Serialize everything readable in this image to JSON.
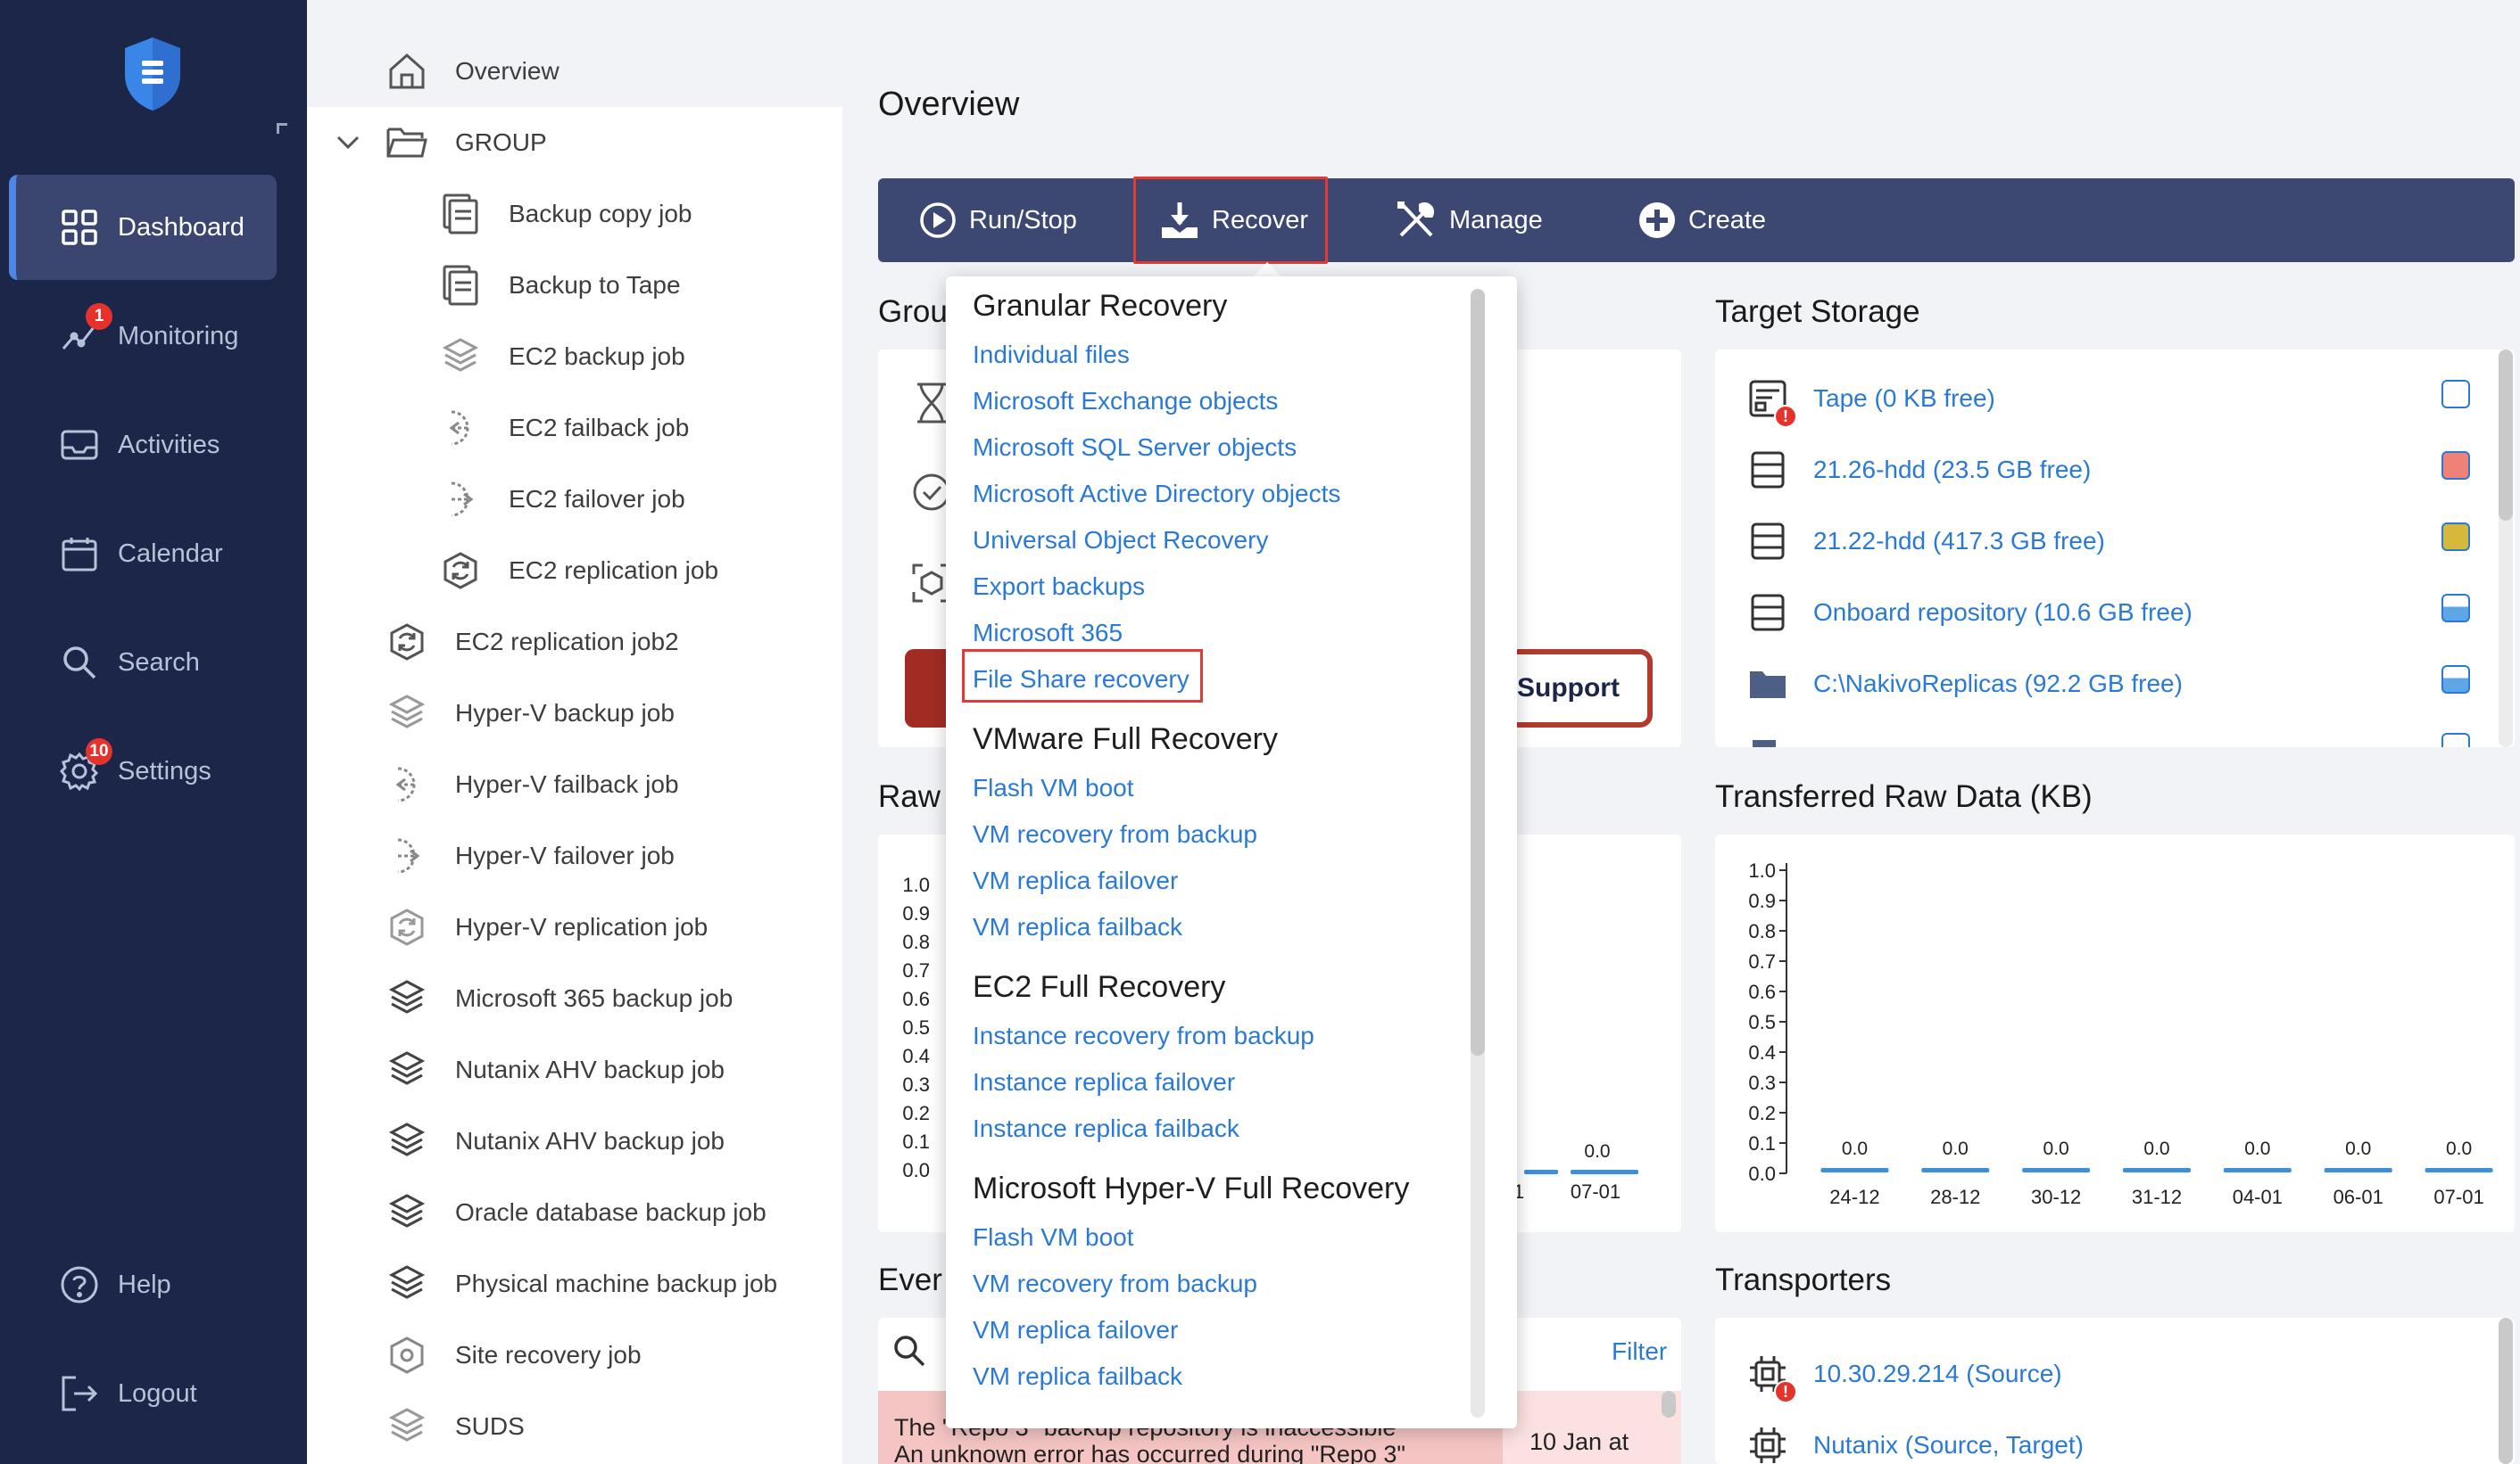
{
  "nav": {
    "items": [
      {
        "label": "Dashboard",
        "icon": "dashboard-grid-icon",
        "active": true
      },
      {
        "label": "Monitoring",
        "icon": "monitoring-icon",
        "badge": "1"
      },
      {
        "label": "Activities",
        "icon": "inbox-icon"
      },
      {
        "label": "Calendar",
        "icon": "calendar-icon"
      },
      {
        "label": "Search",
        "icon": "search-icon"
      },
      {
        "label": "Settings",
        "icon": "gear-icon",
        "badge": "10"
      }
    ],
    "bottom": [
      {
        "label": "Help",
        "icon": "help-icon"
      },
      {
        "label": "Logout",
        "icon": "logout-icon"
      }
    ]
  },
  "tree": {
    "overview": "Overview",
    "group": "GROUP",
    "children": [
      "Backup copy job",
      "Backup to Tape",
      "EC2 backup job",
      "EC2 failback job",
      "EC2 failover job",
      "EC2 replication job"
    ],
    "items": [
      "EC2 replication job2",
      "Hyper-V backup job",
      "Hyper-V failback job",
      "Hyper-V failover job",
      "Hyper-V replication job",
      "Microsoft 365 backup job",
      "Nutanix AHV backup job",
      "Nutanix AHV backup job",
      "Oracle database backup job",
      "Physical machine backup job",
      "Site recovery job",
      "SUDS"
    ]
  },
  "main": {
    "title": "Overview",
    "toolbar": {
      "run_stop": "Run/Stop",
      "recover": "Recover",
      "manage": "Manage",
      "create": "Create"
    },
    "group_title_partial": "Grou",
    "raw_title_partial": "Raw",
    "events_title_partial": "Ever",
    "support_label": "Support",
    "target_storage_title": "Target Storage",
    "transferred_title": "Transferred Raw Data (KB)",
    "transporters_title": "Transporters",
    "filter_label": "Filter",
    "event_text_1": "The \"Repo 3\" backup repository is inaccessible",
    "event_text_2": "An unknown error has occurred during \"Repo 3\"",
    "event_date": "10 Jan at",
    "left_chart_last_label": "07-01",
    "left_chart_last_value": "0.0",
    "left_chart_partial_label": "1"
  },
  "storage": [
    {
      "label": "Tape (0 KB free)",
      "icon": "tape-icon",
      "error": true,
      "color": ""
    },
    {
      "label": "21.26-hdd (23.5 GB free)",
      "icon": "hdd-icon",
      "color": "#ef8277"
    },
    {
      "label": "21.22-hdd (417.3 GB free)",
      "icon": "hdd-icon",
      "color": "#d6b83a"
    },
    {
      "label": "Onboard repository (10.6 GB free)",
      "icon": "hdd-icon",
      "color": "#5fa6e6"
    },
    {
      "label": "C:\\NakivoReplicas (92.2 GB free)",
      "icon": "folder-icon",
      "color": "#5fa6e6"
    }
  ],
  "transporters": [
    {
      "label": "10.30.29.214 (Source)",
      "error": true
    },
    {
      "label": "Nutanix (Source, Target)",
      "error": false
    }
  ],
  "dropdown": {
    "sections": [
      {
        "title": "Granular Recovery",
        "items": [
          "Individual files",
          "Microsoft Exchange objects",
          "Microsoft SQL Server objects",
          "Microsoft Active Directory objects",
          "Universal Object Recovery",
          "Export backups",
          "Microsoft 365",
          "File Share recovery"
        ]
      },
      {
        "title": "VMware Full Recovery",
        "items": [
          "Flash VM boot",
          "VM recovery from backup",
          "VM replica failover",
          "VM replica failback"
        ]
      },
      {
        "title": "EC2 Full Recovery",
        "items": [
          "Instance recovery from backup",
          "Instance replica failover",
          "Instance replica failback"
        ]
      },
      {
        "title": "Microsoft Hyper-V Full Recovery",
        "items": [
          "Flash VM boot",
          "VM recovery from backup",
          "VM replica failover",
          "VM replica failback"
        ]
      }
    ]
  },
  "chart_data": {
    "type": "bar",
    "title": "Transferred Raw Data (KB)",
    "categories": [
      "24-12",
      "28-12",
      "30-12",
      "31-12",
      "04-01",
      "06-01",
      "07-01"
    ],
    "values": [
      0.0,
      0.0,
      0.0,
      0.0,
      0.0,
      0.0,
      0.0
    ],
    "value_labels": [
      "0.0",
      "0.0",
      "0.0",
      "0.0",
      "0.0",
      "0.0",
      "0.0"
    ],
    "y_ticks": [
      "1.0",
      "0.9",
      "0.8",
      "0.7",
      "0.6",
      "0.5",
      "0.4",
      "0.3",
      "0.2",
      "0.1",
      "0.0"
    ],
    "ylim": [
      0,
      1.0
    ],
    "grid": false,
    "bar_color": "#3d8fd6"
  }
}
